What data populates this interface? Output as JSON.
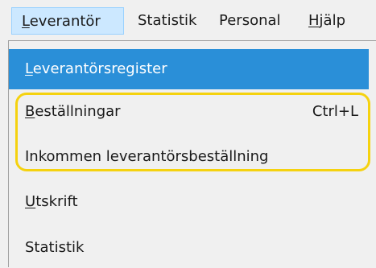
{
  "menubar": {
    "items": [
      {
        "label_accel": "L",
        "label_rest": "everantör"
      },
      {
        "label": "Statistik"
      },
      {
        "label": "Personal"
      },
      {
        "label_accel": "H",
        "label_rest": "jälp"
      }
    ]
  },
  "dropdown": {
    "items": [
      {
        "label_accel": "L",
        "label_rest": "everantörsregister"
      },
      {
        "label_accel": "B",
        "label_rest": "eställningar",
        "shortcut": "Ctrl+L"
      },
      {
        "label": "Inkommen leverantörsbeställning"
      },
      {
        "label_accel": "U",
        "label_rest": "tskrift"
      },
      {
        "label": "Statistik"
      }
    ]
  },
  "colors": {
    "highlight": "#2a8fd8",
    "menubar_active": "#cce8ff",
    "annotation": "#f5d20f"
  }
}
